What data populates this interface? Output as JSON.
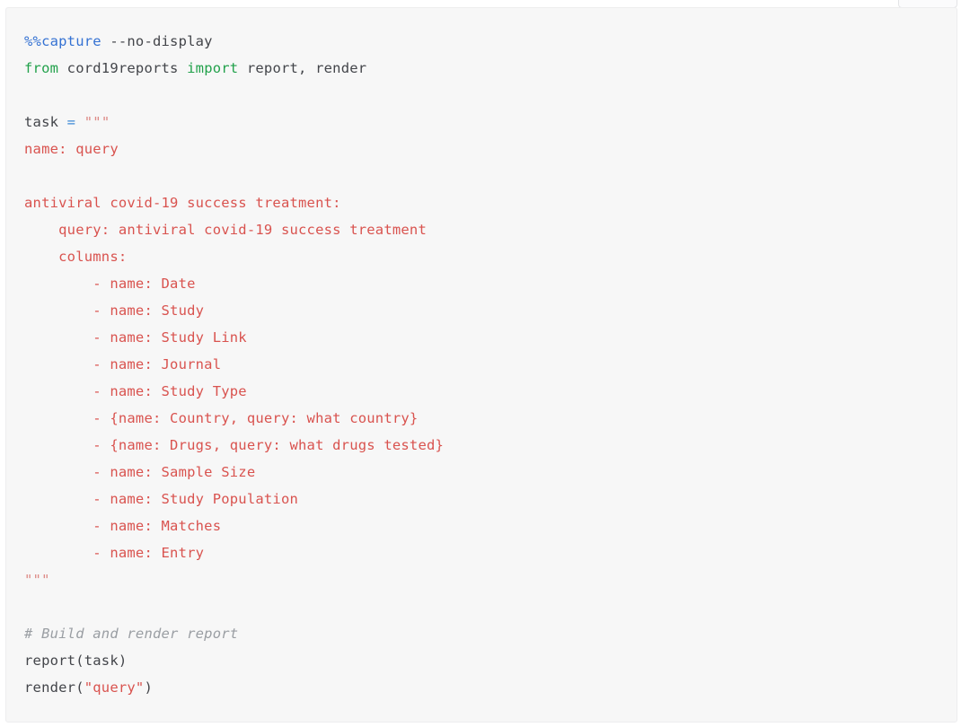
{
  "page": {
    "background": "#ffffff",
    "cell_background": "#f7f7f7",
    "cell_border": "#ededee"
  },
  "top_chip": {
    "name": "partial-toolbar-chip"
  },
  "colors": {
    "magic": "#3572d3",
    "keyword": "#22a14b",
    "plain": "#43454a",
    "operator": "#3f8bd6",
    "string": "#d9534f",
    "string_dim": "#dd8a86",
    "comment": "#9a9ea3"
  },
  "code_cell": {
    "language": "python",
    "lines": [
      {
        "id": "l1",
        "tokens": [
          {
            "t": "%%capture",
            "c": "tok-magic"
          },
          {
            "t": " --no-display",
            "c": "tok-plain"
          }
        ]
      },
      {
        "id": "l2",
        "tokens": [
          {
            "t": "from",
            "c": "tok-kw"
          },
          {
            "t": " cord19reports ",
            "c": "tok-plain"
          },
          {
            "t": "import",
            "c": "tok-kw"
          },
          {
            "t": " report, render",
            "c": "tok-plain"
          }
        ]
      },
      {
        "id": "l3",
        "tokens": [
          {
            "t": " ",
            "c": "tok-plain"
          }
        ]
      },
      {
        "id": "l4",
        "tokens": [
          {
            "t": "task ",
            "c": "tok-plain"
          },
          {
            "t": "=",
            "c": "tok-op"
          },
          {
            "t": " ",
            "c": "tok-plain"
          },
          {
            "t": "\"\"\"",
            "c": "tok-str-dim"
          }
        ]
      },
      {
        "id": "l5",
        "tokens": [
          {
            "t": "name: query",
            "c": "tok-str"
          }
        ]
      },
      {
        "id": "l6",
        "tokens": [
          {
            "t": " ",
            "c": "tok-plain"
          }
        ]
      },
      {
        "id": "l7",
        "tokens": [
          {
            "t": "antiviral covid-19 success treatment:",
            "c": "tok-str"
          }
        ]
      },
      {
        "id": "l8",
        "tokens": [
          {
            "t": "    query: antiviral covid-19 success treatment",
            "c": "tok-str"
          }
        ]
      },
      {
        "id": "l9",
        "tokens": [
          {
            "t": "    columns:",
            "c": "tok-str"
          }
        ]
      },
      {
        "id": "l10",
        "tokens": [
          {
            "t": "        - name: Date",
            "c": "tok-str"
          }
        ]
      },
      {
        "id": "l11",
        "tokens": [
          {
            "t": "        - name: Study",
            "c": "tok-str"
          }
        ]
      },
      {
        "id": "l12",
        "tokens": [
          {
            "t": "        - name: Study Link",
            "c": "tok-str"
          }
        ]
      },
      {
        "id": "l13",
        "tokens": [
          {
            "t": "        - name: Journal",
            "c": "tok-str"
          }
        ]
      },
      {
        "id": "l14",
        "tokens": [
          {
            "t": "        - name: Study Type",
            "c": "tok-str"
          }
        ]
      },
      {
        "id": "l15",
        "tokens": [
          {
            "t": "        - {name: Country, query: what country}",
            "c": "tok-str"
          }
        ]
      },
      {
        "id": "l16",
        "tokens": [
          {
            "t": "        - {name: Drugs, query: what drugs tested}",
            "c": "tok-str"
          }
        ]
      },
      {
        "id": "l17",
        "tokens": [
          {
            "t": "        - name: Sample Size",
            "c": "tok-str"
          }
        ]
      },
      {
        "id": "l18",
        "tokens": [
          {
            "t": "        - name: Study Population",
            "c": "tok-str"
          }
        ]
      },
      {
        "id": "l19",
        "tokens": [
          {
            "t": "        - name: Matches",
            "c": "tok-str"
          }
        ]
      },
      {
        "id": "l20",
        "tokens": [
          {
            "t": "        - name: Entry",
            "c": "tok-str"
          }
        ]
      },
      {
        "id": "l21",
        "tokens": [
          {
            "t": "\"\"\"",
            "c": "tok-str-dim"
          }
        ]
      },
      {
        "id": "l22",
        "tokens": [
          {
            "t": " ",
            "c": "tok-plain"
          }
        ]
      },
      {
        "id": "l23",
        "tokens": [
          {
            "t": "# Build and render report",
            "c": "tok-comment"
          }
        ]
      },
      {
        "id": "l24",
        "tokens": [
          {
            "t": "report(task)",
            "c": "tok-plain"
          }
        ]
      },
      {
        "id": "l25",
        "tokens": [
          {
            "t": "render(",
            "c": "tok-plain"
          },
          {
            "t": "\"query\"",
            "c": "tok-str"
          },
          {
            "t": ")",
            "c": "tok-plain"
          }
        ]
      }
    ]
  }
}
